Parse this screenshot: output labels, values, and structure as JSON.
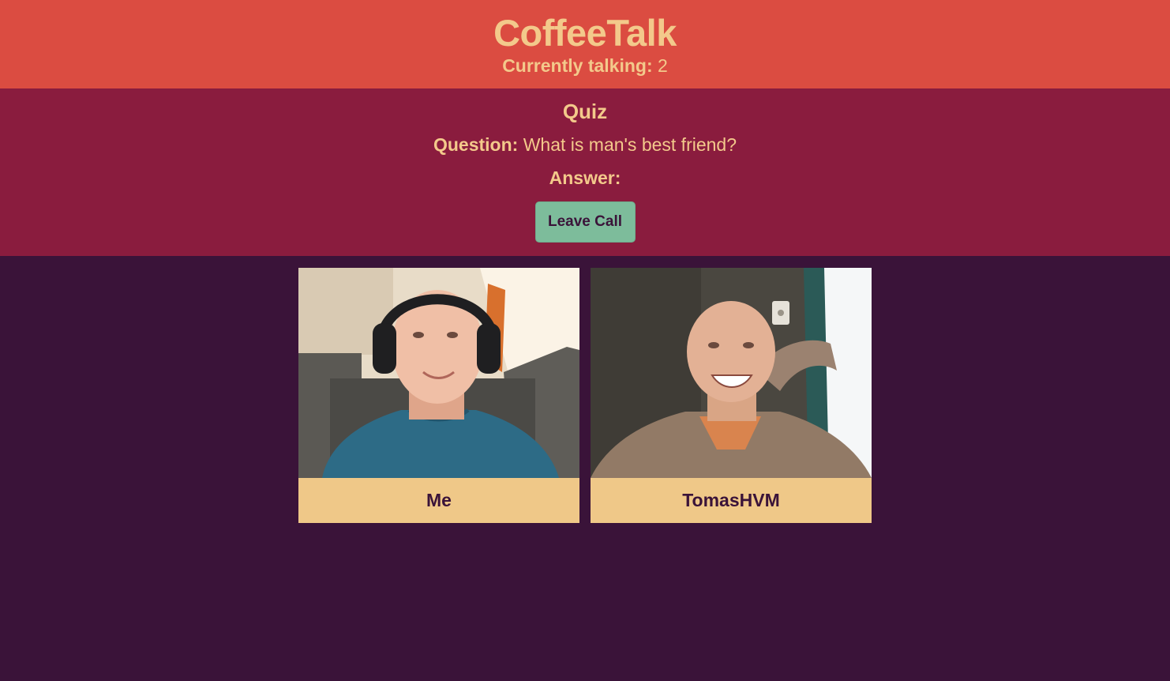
{
  "header": {
    "title": "CoffeeTalk",
    "talking_label": "Currently talking:",
    "talking_count": "2"
  },
  "quiz": {
    "title": "Quiz",
    "question_label": "Question:",
    "question_text": "What is man's best friend?",
    "answer_label": "Answer:",
    "answer_text": ""
  },
  "controls": {
    "leave_label": "Leave Call"
  },
  "participants": [
    {
      "name": "Me"
    },
    {
      "name": "TomasHVM"
    }
  ],
  "colors": {
    "header_bg": "#db4c41",
    "quiz_bg": "#8a1c3e",
    "page_bg": "#3a1339",
    "text": "#f3c98b",
    "button_bg": "#7dbc9b",
    "name_bar_bg": "#efc888"
  }
}
